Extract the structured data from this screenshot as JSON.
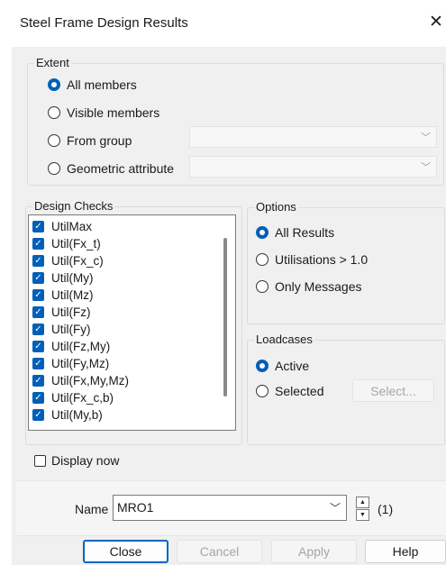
{
  "dialog": {
    "title": "Steel Frame Design Results"
  },
  "extent": {
    "label": "Extent",
    "options": [
      "All members",
      "Visible members",
      "From group",
      "Geometric attribute"
    ],
    "selected": "All members"
  },
  "design_checks": {
    "label": "Design Checks",
    "items": [
      "UtilMax",
      "Util(Fx_t)",
      "Util(Fx_c)",
      "Util(My)",
      "Util(Mz)",
      "Util(Fz)",
      "Util(Fy)",
      "Util(Fz,My)",
      "Util(Fy,Mz)",
      "Util(Fx,My,Mz)",
      "Util(Fx_c,b)",
      "Util(My,b)"
    ]
  },
  "options": {
    "label": "Options",
    "items": [
      "All Results",
      "Utilisations > 1.0",
      "Only Messages"
    ],
    "selected": "All Results"
  },
  "loadcases": {
    "label": "Loadcases",
    "items": [
      "Active",
      "Selected"
    ],
    "selected": "Active",
    "select_button": "Select..."
  },
  "display_now": {
    "label": "Display now",
    "checked": false
  },
  "name": {
    "label": "Name",
    "value": "MRO1",
    "count": "(1)"
  },
  "buttons": {
    "close": "Close",
    "cancel": "Cancel",
    "apply": "Apply",
    "help": "Help"
  },
  "icons": {
    "close": "close-icon",
    "dropdown": "chevron-down-icon",
    "spin_up": "spin-up-icon",
    "spin_down": "spin-down-icon"
  },
  "colors": {
    "accent": "#005fb8",
    "default_button_border": "#0067c0",
    "panel": "#f0f0f0"
  }
}
